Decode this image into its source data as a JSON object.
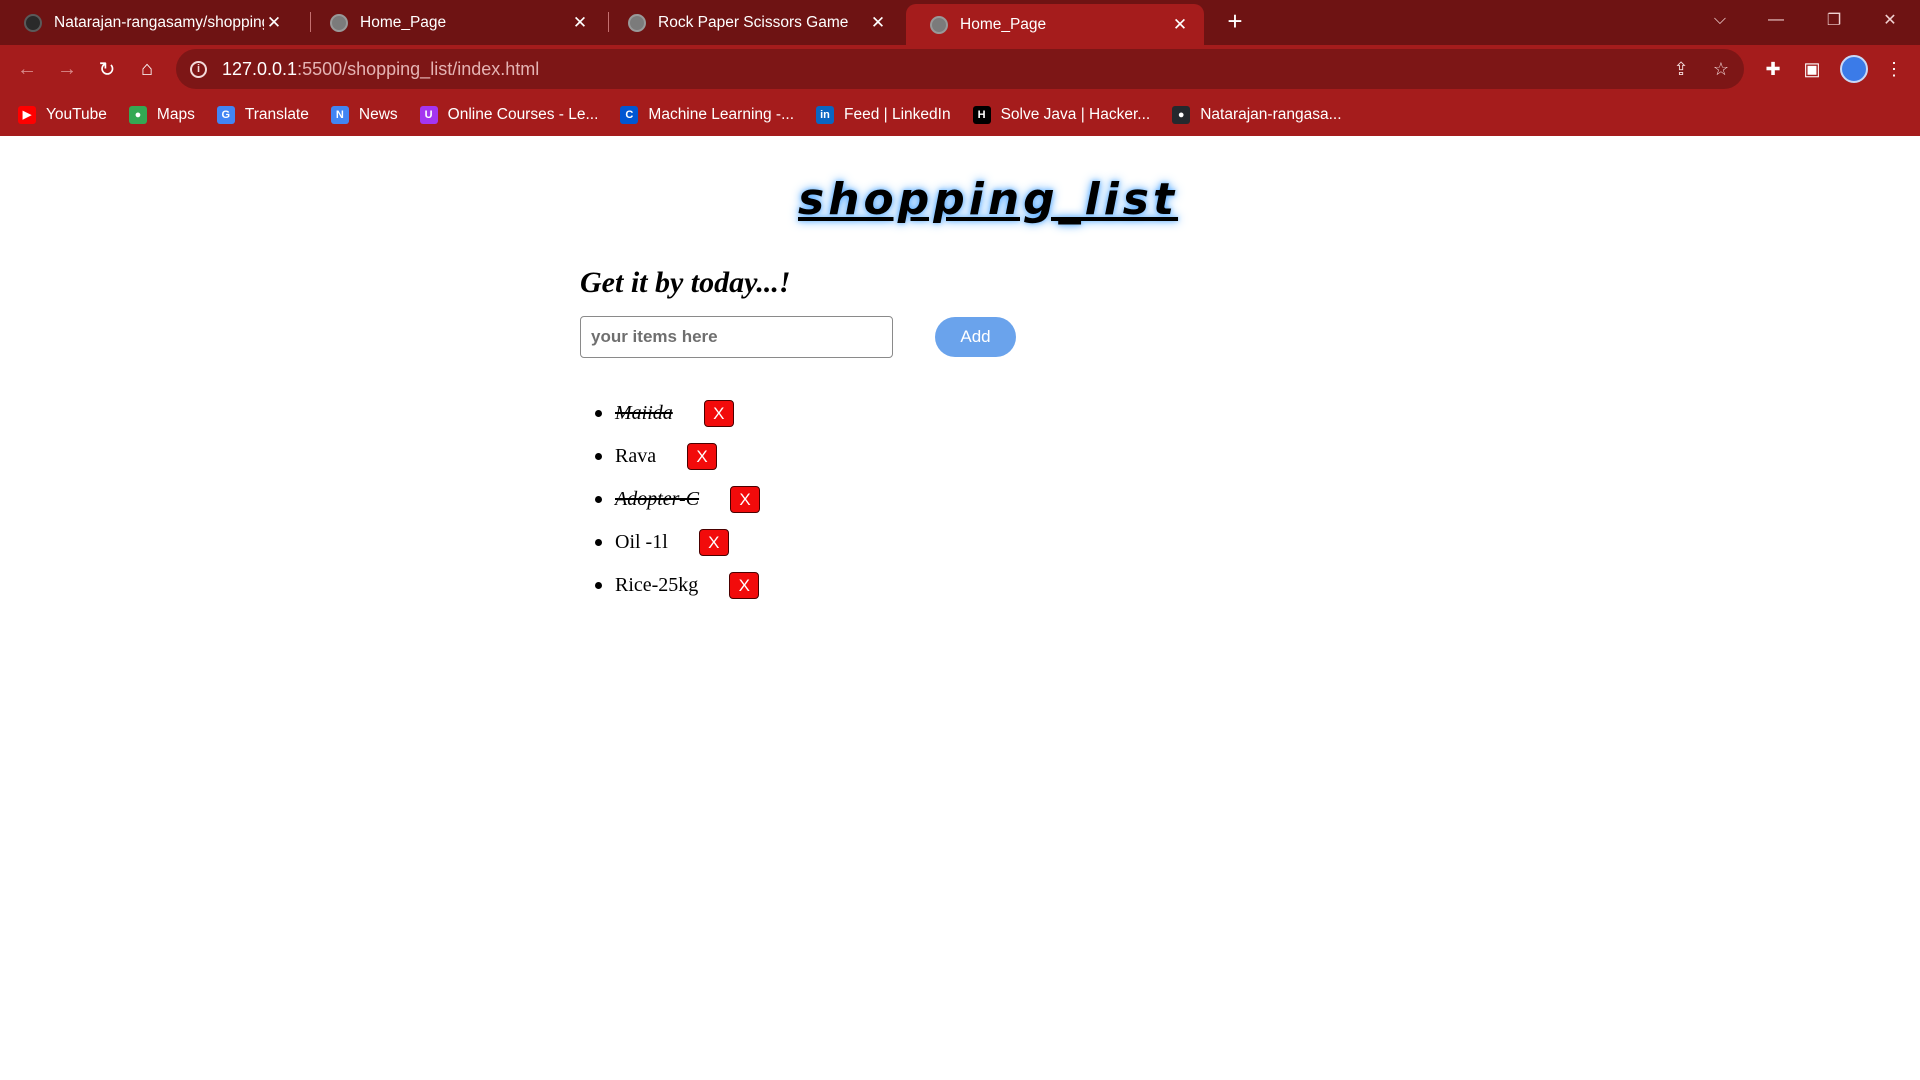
{
  "browser": {
    "tabs": [
      {
        "title": "Natarajan-rangasamy/shopping_",
        "icon": "github-icon",
        "active": false
      },
      {
        "title": "Home_Page",
        "icon": "globe-icon",
        "active": false
      },
      {
        "title": "Rock Paper Scissors Game",
        "icon": "globe-icon",
        "active": false
      },
      {
        "title": "Home_Page",
        "icon": "globe-icon",
        "active": true
      }
    ],
    "tab_close_glyph": "✕",
    "new_tab_glyph": "+",
    "url_host": "127.0.0.1",
    "url_path": ":5500/shopping_list/index.html",
    "bookmarks": [
      {
        "label": "YouTube",
        "icon": "youtube-icon",
        "color": "#ff0000",
        "glyph": "▶"
      },
      {
        "label": "Maps",
        "icon": "maps-icon",
        "color": "#34a853",
        "glyph": "●"
      },
      {
        "label": "Translate",
        "icon": "translate-icon",
        "color": "#4285f4",
        "glyph": "G"
      },
      {
        "label": "News",
        "icon": "news-icon",
        "color": "#4285f4",
        "glyph": "N"
      },
      {
        "label": "Online Courses - Le...",
        "icon": "udemy-icon",
        "color": "#a435f0",
        "glyph": "U"
      },
      {
        "label": "Machine Learning -...",
        "icon": "coursera-icon",
        "color": "#0056d2",
        "glyph": "C"
      },
      {
        "label": "Feed | LinkedIn",
        "icon": "linkedin-icon",
        "color": "#0a66c2",
        "glyph": "in"
      },
      {
        "label": "Solve Java | Hacker...",
        "icon": "hackerrank-icon",
        "color": "#000000",
        "glyph": "H"
      },
      {
        "label": "Natarajan-rangasa...",
        "icon": "github-icon",
        "color": "#24292e",
        "glyph": "●"
      }
    ]
  },
  "app": {
    "title": "shopping_list",
    "subtitle": "Get it by today...!",
    "input_placeholder": "your items here",
    "add_label": "Add",
    "delete_label": "X",
    "items": [
      {
        "text": "Maiida",
        "done": true
      },
      {
        "text": "Rava",
        "done": false
      },
      {
        "text": "Adopter-C",
        "done": true
      },
      {
        "text": "Oil -1l",
        "done": false
      },
      {
        "text": "Rice-25kg",
        "done": false
      }
    ]
  }
}
